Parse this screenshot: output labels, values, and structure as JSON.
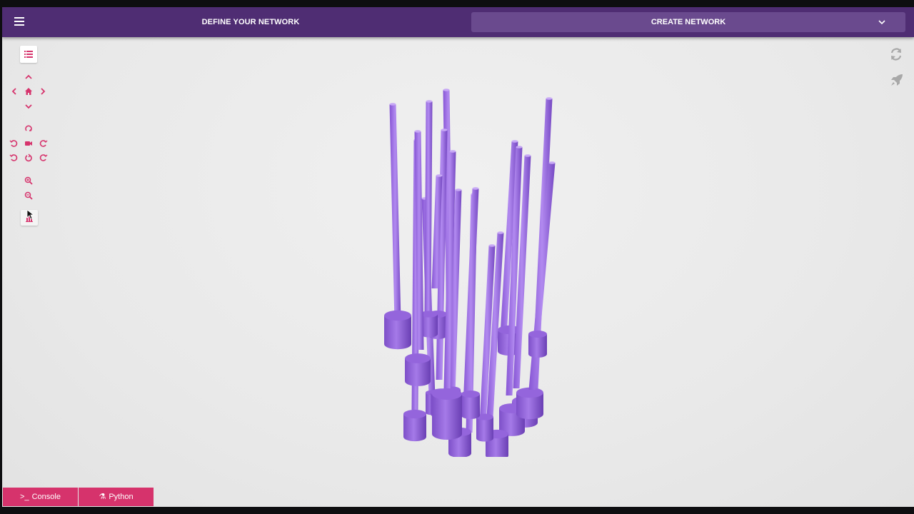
{
  "topbar": {
    "define_label": "DEFINE YOUR NETWORK",
    "create_label": "CREATE NETWORK"
  },
  "icons": {
    "menu": "hamburger-icon",
    "list": "list-icon",
    "pan": [
      "chevron-up-icon",
      "chevron-left-icon",
      "home-icon",
      "chevron-right-icon",
      "chevron-down-icon"
    ],
    "rotate": [
      "rotate-up-icon",
      "rotate-left-icon",
      "camera-icon",
      "rotate-right-icon",
      "rotate-ccw-icon",
      "rotate-reset-icon",
      "rotate-cw-icon"
    ],
    "zoom": [
      "zoom-in-icon",
      "zoom-out-icon"
    ],
    "chart": "bar-chart-icon",
    "right": [
      "refresh-icon",
      "rocket-icon"
    ]
  },
  "colors": {
    "topbar": "#4f2d73",
    "create_tab": "#6a4a8e",
    "accent": "#d6336c",
    "neuron": "#9a6ae0"
  },
  "bottom_tabs": [
    {
      "glyph": ">_",
      "label": "Console"
    },
    {
      "glyph": "⚗",
      "label": "Python"
    }
  ]
}
